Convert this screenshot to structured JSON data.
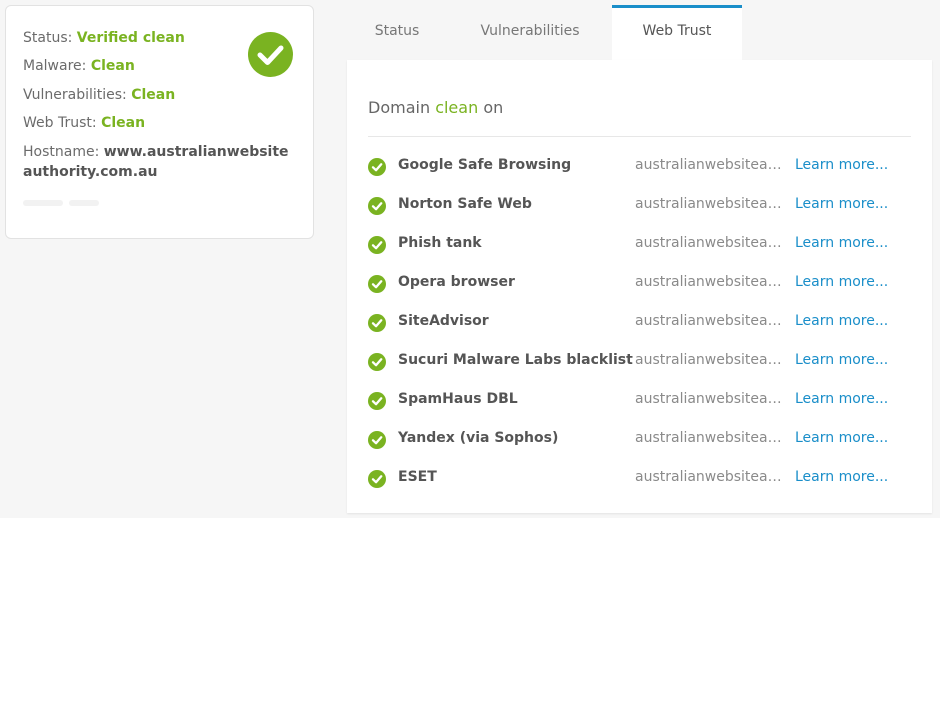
{
  "summary": {
    "status_label": "Status:",
    "status_value": "Verified clean",
    "malware_label": "Malware:",
    "malware_value": "Clean",
    "vulnerabilities_label": "Vulnerabilities:",
    "vulnerabilities_value": "Clean",
    "webtrust_label": "Web Trust:",
    "webtrust_value": "Clean",
    "hostname_label": "Hostname:",
    "hostname_value": "www.australianwebsiteauthority.com.au",
    "status_icon": "check-circle-icon"
  },
  "tabs": [
    {
      "label": "Status"
    },
    {
      "label": "Vulnerabilities"
    },
    {
      "label": "Web Trust"
    }
  ],
  "active_tab": "Web Trust",
  "panel": {
    "heading_prefix": "Domain",
    "heading_status": "clean",
    "heading_suffix": "on",
    "items": [
      {
        "name": "Google Safe Browsing",
        "domain": "australianwebsiteauthority.com.au",
        "link": "Learn more..."
      },
      {
        "name": "Norton Safe Web",
        "domain": "australianwebsiteauthority.com.au",
        "link": "Learn more..."
      },
      {
        "name": "Phish tank",
        "domain": "australianwebsiteauthority.com.au",
        "link": "Learn more..."
      },
      {
        "name": "Opera browser",
        "domain": "australianwebsiteauthority.com.au",
        "link": "Learn more..."
      },
      {
        "name": "SiteAdvisor",
        "domain": "australianwebsiteauthority.com.au",
        "link": "Learn more..."
      },
      {
        "name": "Sucuri Malware Labs blacklist",
        "domain": "australianwebsiteauthority.com.au",
        "link": "Learn more..."
      },
      {
        "name": "SpamHaus DBL",
        "domain": "australianwebsiteauthority.com.au",
        "link": "Learn more..."
      },
      {
        "name": "Yandex (via Sophos)",
        "domain": "australianwebsiteauthority.com.au",
        "link": "Learn more..."
      },
      {
        "name": "ESET",
        "domain": "australianwebsiteauthority.com.au",
        "link": "Learn more..."
      }
    ]
  },
  "colors": {
    "clean_green": "#7ab321",
    "link_blue": "#1a8ec9",
    "active_tab_border": "#1a8ec9"
  }
}
